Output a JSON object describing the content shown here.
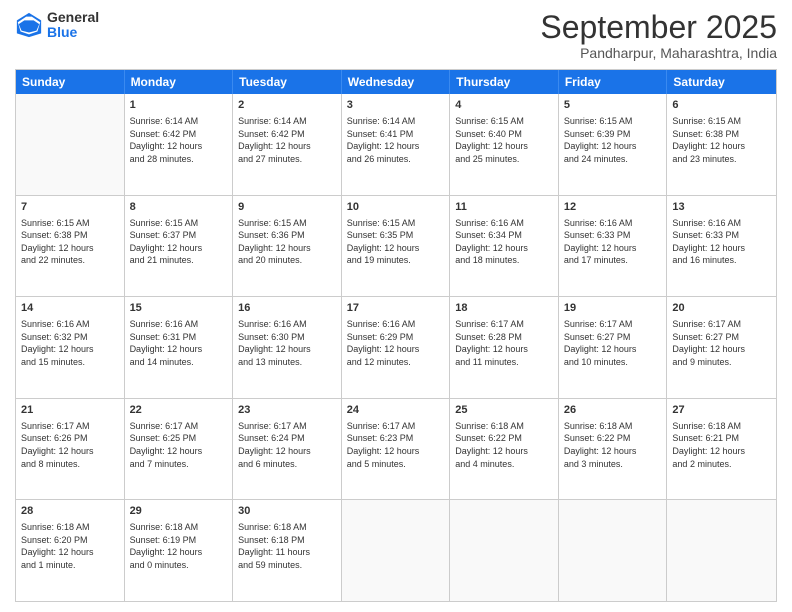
{
  "logo": {
    "general": "General",
    "blue": "Blue"
  },
  "title": "September 2025",
  "subtitle": "Pandharpur, Maharashtra, India",
  "header_days": [
    "Sunday",
    "Monday",
    "Tuesday",
    "Wednesday",
    "Thursday",
    "Friday",
    "Saturday"
  ],
  "weeks": [
    [
      {
        "day": "",
        "text": ""
      },
      {
        "day": "1",
        "text": "Sunrise: 6:14 AM\nSunset: 6:42 PM\nDaylight: 12 hours\nand 28 minutes."
      },
      {
        "day": "2",
        "text": "Sunrise: 6:14 AM\nSunset: 6:42 PM\nDaylight: 12 hours\nand 27 minutes."
      },
      {
        "day": "3",
        "text": "Sunrise: 6:14 AM\nSunset: 6:41 PM\nDaylight: 12 hours\nand 26 minutes."
      },
      {
        "day": "4",
        "text": "Sunrise: 6:15 AM\nSunset: 6:40 PM\nDaylight: 12 hours\nand 25 minutes."
      },
      {
        "day": "5",
        "text": "Sunrise: 6:15 AM\nSunset: 6:39 PM\nDaylight: 12 hours\nand 24 minutes."
      },
      {
        "day": "6",
        "text": "Sunrise: 6:15 AM\nSunset: 6:38 PM\nDaylight: 12 hours\nand 23 minutes."
      }
    ],
    [
      {
        "day": "7",
        "text": "Sunrise: 6:15 AM\nSunset: 6:38 PM\nDaylight: 12 hours\nand 22 minutes."
      },
      {
        "day": "8",
        "text": "Sunrise: 6:15 AM\nSunset: 6:37 PM\nDaylight: 12 hours\nand 21 minutes."
      },
      {
        "day": "9",
        "text": "Sunrise: 6:15 AM\nSunset: 6:36 PM\nDaylight: 12 hours\nand 20 minutes."
      },
      {
        "day": "10",
        "text": "Sunrise: 6:15 AM\nSunset: 6:35 PM\nDaylight: 12 hours\nand 19 minutes."
      },
      {
        "day": "11",
        "text": "Sunrise: 6:16 AM\nSunset: 6:34 PM\nDaylight: 12 hours\nand 18 minutes."
      },
      {
        "day": "12",
        "text": "Sunrise: 6:16 AM\nSunset: 6:33 PM\nDaylight: 12 hours\nand 17 minutes."
      },
      {
        "day": "13",
        "text": "Sunrise: 6:16 AM\nSunset: 6:33 PM\nDaylight: 12 hours\nand 16 minutes."
      }
    ],
    [
      {
        "day": "14",
        "text": "Sunrise: 6:16 AM\nSunset: 6:32 PM\nDaylight: 12 hours\nand 15 minutes."
      },
      {
        "day": "15",
        "text": "Sunrise: 6:16 AM\nSunset: 6:31 PM\nDaylight: 12 hours\nand 14 minutes."
      },
      {
        "day": "16",
        "text": "Sunrise: 6:16 AM\nSunset: 6:30 PM\nDaylight: 12 hours\nand 13 minutes."
      },
      {
        "day": "17",
        "text": "Sunrise: 6:16 AM\nSunset: 6:29 PM\nDaylight: 12 hours\nand 12 minutes."
      },
      {
        "day": "18",
        "text": "Sunrise: 6:17 AM\nSunset: 6:28 PM\nDaylight: 12 hours\nand 11 minutes."
      },
      {
        "day": "19",
        "text": "Sunrise: 6:17 AM\nSunset: 6:27 PM\nDaylight: 12 hours\nand 10 minutes."
      },
      {
        "day": "20",
        "text": "Sunrise: 6:17 AM\nSunset: 6:27 PM\nDaylight: 12 hours\nand 9 minutes."
      }
    ],
    [
      {
        "day": "21",
        "text": "Sunrise: 6:17 AM\nSunset: 6:26 PM\nDaylight: 12 hours\nand 8 minutes."
      },
      {
        "day": "22",
        "text": "Sunrise: 6:17 AM\nSunset: 6:25 PM\nDaylight: 12 hours\nand 7 minutes."
      },
      {
        "day": "23",
        "text": "Sunrise: 6:17 AM\nSunset: 6:24 PM\nDaylight: 12 hours\nand 6 minutes."
      },
      {
        "day": "24",
        "text": "Sunrise: 6:17 AM\nSunset: 6:23 PM\nDaylight: 12 hours\nand 5 minutes."
      },
      {
        "day": "25",
        "text": "Sunrise: 6:18 AM\nSunset: 6:22 PM\nDaylight: 12 hours\nand 4 minutes."
      },
      {
        "day": "26",
        "text": "Sunrise: 6:18 AM\nSunset: 6:22 PM\nDaylight: 12 hours\nand 3 minutes."
      },
      {
        "day": "27",
        "text": "Sunrise: 6:18 AM\nSunset: 6:21 PM\nDaylight: 12 hours\nand 2 minutes."
      }
    ],
    [
      {
        "day": "28",
        "text": "Sunrise: 6:18 AM\nSunset: 6:20 PM\nDaylight: 12 hours\nand 1 minute."
      },
      {
        "day": "29",
        "text": "Sunrise: 6:18 AM\nSunset: 6:19 PM\nDaylight: 12 hours\nand 0 minutes."
      },
      {
        "day": "30",
        "text": "Sunrise: 6:18 AM\nSunset: 6:18 PM\nDaylight: 11 hours\nand 59 minutes."
      },
      {
        "day": "",
        "text": ""
      },
      {
        "day": "",
        "text": ""
      },
      {
        "day": "",
        "text": ""
      },
      {
        "day": "",
        "text": ""
      }
    ]
  ]
}
